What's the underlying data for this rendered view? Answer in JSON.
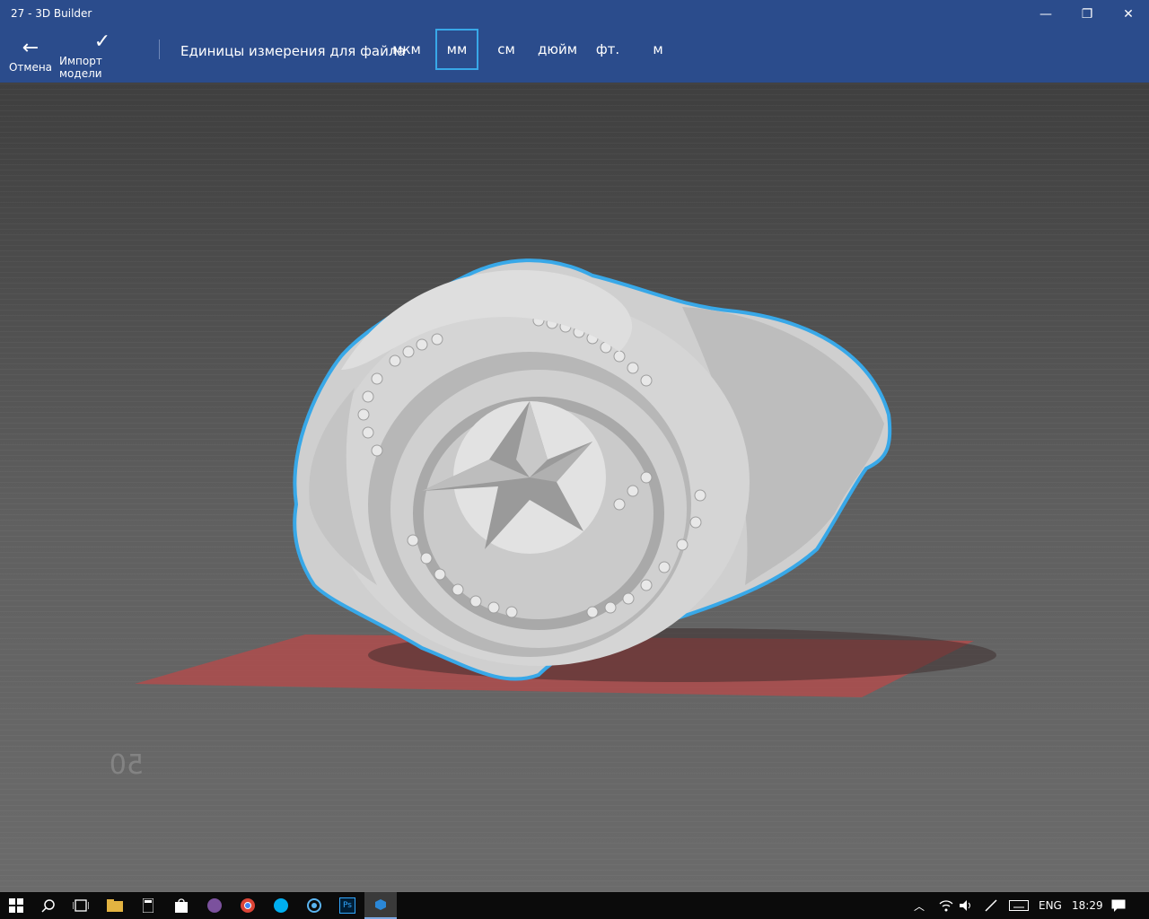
{
  "window": {
    "title": "27 - 3D Builder"
  },
  "titlebar_controls": {
    "minimize_icon": "—",
    "restore_icon": "❐",
    "close_icon": "✕"
  },
  "toolbar": {
    "cancel_label": "Отмена",
    "cancel_icon": "←",
    "import_label": "Импорт модели",
    "import_icon": "✓",
    "units_label": "Единицы измерения для файла",
    "units": [
      "мкм",
      "мм",
      "см",
      "дюйм",
      "фт.",
      "м"
    ],
    "selected_unit": "мм"
  },
  "viewport": {
    "floor_label": "50",
    "selection_color": "#38a8e8",
    "shadow_color": "#b84a4a"
  },
  "taskbar": {
    "apps": [
      "start-icon",
      "search-icon",
      "task-view-icon",
      "file-explorer-icon",
      "calculator-icon",
      "store-icon",
      "viber-icon",
      "chrome-icon",
      "skype-icon",
      "camera-icon",
      "photoshop-icon",
      "3d-builder-icon"
    ],
    "ps_label": "Ps",
    "language": "ENG",
    "time": "18:29"
  }
}
